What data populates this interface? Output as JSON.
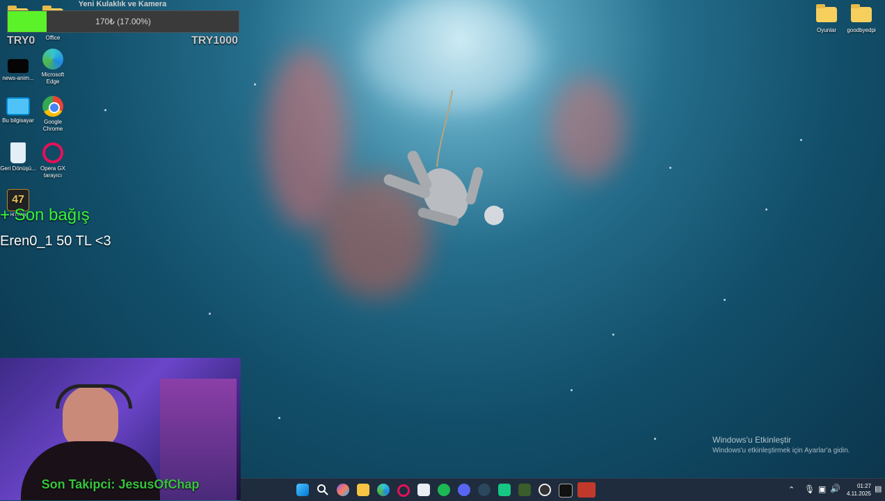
{
  "donation_goal": {
    "title": "Yeni Kulaklık ve Kamera",
    "progress_text": "170₺ (17.00%)",
    "progress_fraction": 0.17,
    "min_label": "TRY0",
    "max_label": "TRY1000"
  },
  "desktop_icons_left": [
    {
      "label": "Office"
    },
    {
      "label": "news-anim..."
    },
    {
      "label": "Microsoft Edge"
    },
    {
      "label": "Bu bilgisayar"
    },
    {
      "label": "Google Chrome"
    },
    {
      "label": "Geri Dönüşü..."
    },
    {
      "label": "Opera GX tarayıcı"
    },
    {
      "label": "HITMAN"
    }
  ],
  "desktop_icons_right": [
    {
      "label": "Oyunlar"
    },
    {
      "label": "goodbyedpi"
    }
  ],
  "last_donation": {
    "heading": "+ Son bağış",
    "text": "Eren0_1 50 TL <3"
  },
  "webcam": {
    "follower_text": "Son Takipci: JesusOfChap"
  },
  "windows_activation": {
    "title": "Windows'u Etkinleştir",
    "subtitle": "Windows'u etkinleştirmek için Ayarlar'a gidin."
  },
  "taskbar": {
    "time": "01:27",
    "date": "4.11.2025"
  },
  "colors": {
    "progress_green": "#5cf229",
    "donation_heading": "#39f33b",
    "follower_text": "#35c43a"
  }
}
